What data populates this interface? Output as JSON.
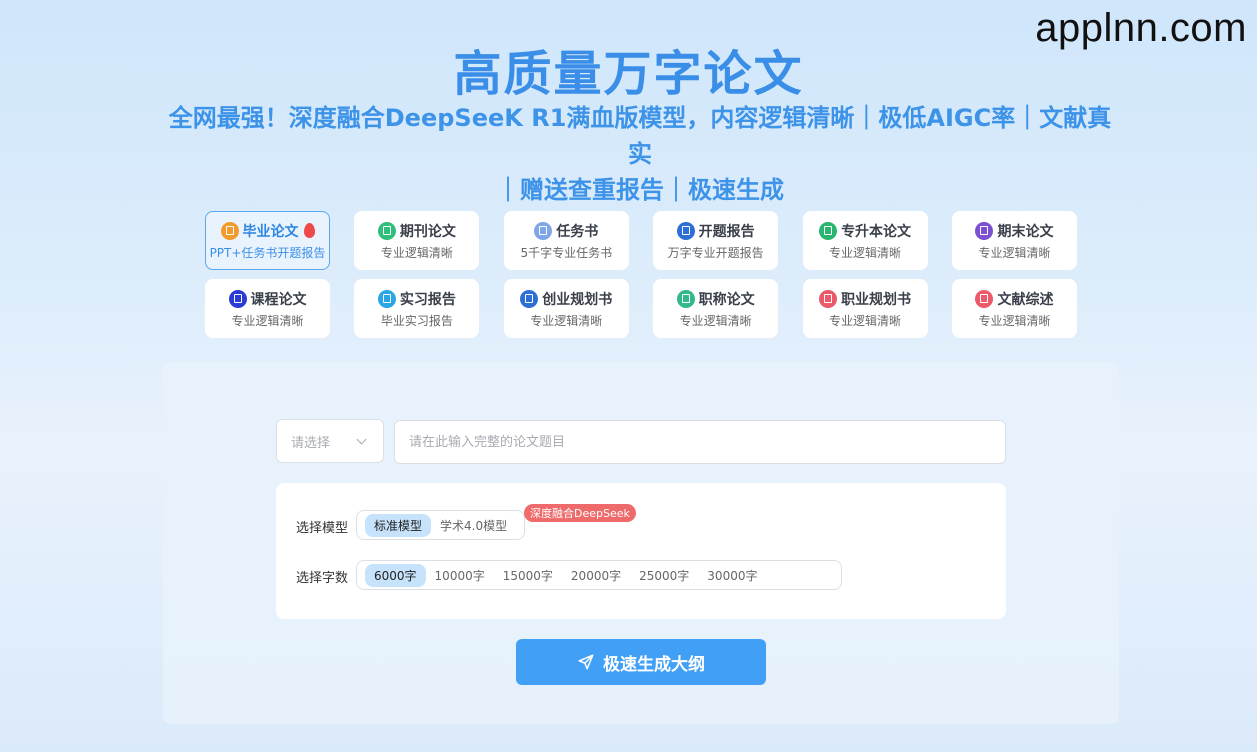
{
  "watermark": "applnn.com",
  "header": {
    "title": "高质量万字论文",
    "subtitle_line1": "全网最强！深度融合DeepSeeK R1满血版模型，内容逻辑清晰｜极低AIGC率｜文献真实",
    "subtitle_line2": "｜赠送查重报告｜极速生成"
  },
  "cards": [
    {
      "name": "毕业论文",
      "desc": "PPT+任务书开题报告",
      "icon": "document-icon",
      "color": "#f39a2c",
      "active": true,
      "hot": true
    },
    {
      "name": "期刊论文",
      "desc": "专业逻辑清晰",
      "icon": "document-icon",
      "color": "#2ebf7a"
    },
    {
      "name": "任务书",
      "desc": "5千字专业任务书",
      "icon": "document-icon",
      "color": "#7fa6e8"
    },
    {
      "name": "开题报告",
      "desc": "万字专业开题报告",
      "icon": "report-icon",
      "color": "#2d6fd6"
    },
    {
      "name": "专升本论文",
      "desc": "专业逻辑清晰",
      "icon": "book-icon",
      "color": "#28b56e"
    },
    {
      "name": "期末论文",
      "desc": "专业逻辑清晰",
      "icon": "document-icon",
      "color": "#7c4fd0"
    },
    {
      "name": "课程论文",
      "desc": "专业逻辑清晰",
      "icon": "report-icon",
      "color": "#2b3bd6"
    },
    {
      "name": "实习报告",
      "desc": "毕业实习报告",
      "icon": "document-icon",
      "color": "#29a6e6"
    },
    {
      "name": "创业规划书",
      "desc": "专业逻辑清晰",
      "icon": "document-icon",
      "color": "#2d6fd6"
    },
    {
      "name": "职称论文",
      "desc": "专业逻辑清晰",
      "icon": "report-icon",
      "color": "#32b88b"
    },
    {
      "name": "职业规划书",
      "desc": "专业逻辑清晰",
      "icon": "list-icon",
      "color": "#ea5a6a"
    },
    {
      "name": "文献综述",
      "desc": "专业逻辑清晰",
      "icon": "list-icon",
      "color": "#ea5a6a"
    }
  ],
  "form": {
    "select_placeholder": "请选择",
    "topic_placeholder": "请在此输入完整的论文题目",
    "model_label": "选择模型",
    "models": [
      {
        "label": "标准模型",
        "selected": true
      },
      {
        "label": "学术4.0模型",
        "selected": false
      }
    ],
    "model_badge": "深度融合DeepSeek",
    "words_label": "选择字数",
    "word_counts": [
      {
        "label": "6000字",
        "selected": true
      },
      {
        "label": "10000字",
        "selected": false
      },
      {
        "label": "15000字",
        "selected": false
      },
      {
        "label": "20000字",
        "selected": false
      },
      {
        "label": "25000字",
        "selected": false
      },
      {
        "label": "30000字",
        "selected": false
      }
    ],
    "generate_label": "极速生成大纲"
  }
}
